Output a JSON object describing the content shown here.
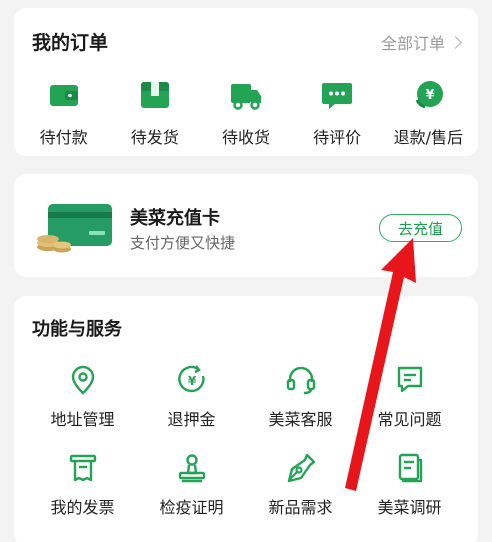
{
  "colors": {
    "accent": "#23a455",
    "annotation": "#e8161b"
  },
  "orders": {
    "title": "我的订单",
    "all_link": "全部订单",
    "items": [
      {
        "label": "待付款",
        "icon": "wallet-icon"
      },
      {
        "label": "待发货",
        "icon": "package-icon"
      },
      {
        "label": "待收货",
        "icon": "truck-icon"
      },
      {
        "label": "待评价",
        "icon": "chat-bubble-icon"
      },
      {
        "label": "退款/售后",
        "icon": "refund-yen-icon"
      }
    ]
  },
  "recharge": {
    "title": "美菜充值卡",
    "subtitle": "支付方便又快捷",
    "button": "去充值"
  },
  "services": {
    "title": "功能与服务",
    "items": [
      {
        "label": "地址管理",
        "icon": "location-pin-icon"
      },
      {
        "label": "退押金",
        "icon": "deposit-refund-icon"
      },
      {
        "label": "美菜客服",
        "icon": "headset-icon"
      },
      {
        "label": "常见问题",
        "icon": "faq-message-icon"
      },
      {
        "label": "我的发票",
        "icon": "invoice-icon"
      },
      {
        "label": "检疫证明",
        "icon": "stamp-icon"
      },
      {
        "label": "新品需求",
        "icon": "pen-nib-icon"
      },
      {
        "label": "美菜调研",
        "icon": "survey-icon"
      }
    ]
  }
}
